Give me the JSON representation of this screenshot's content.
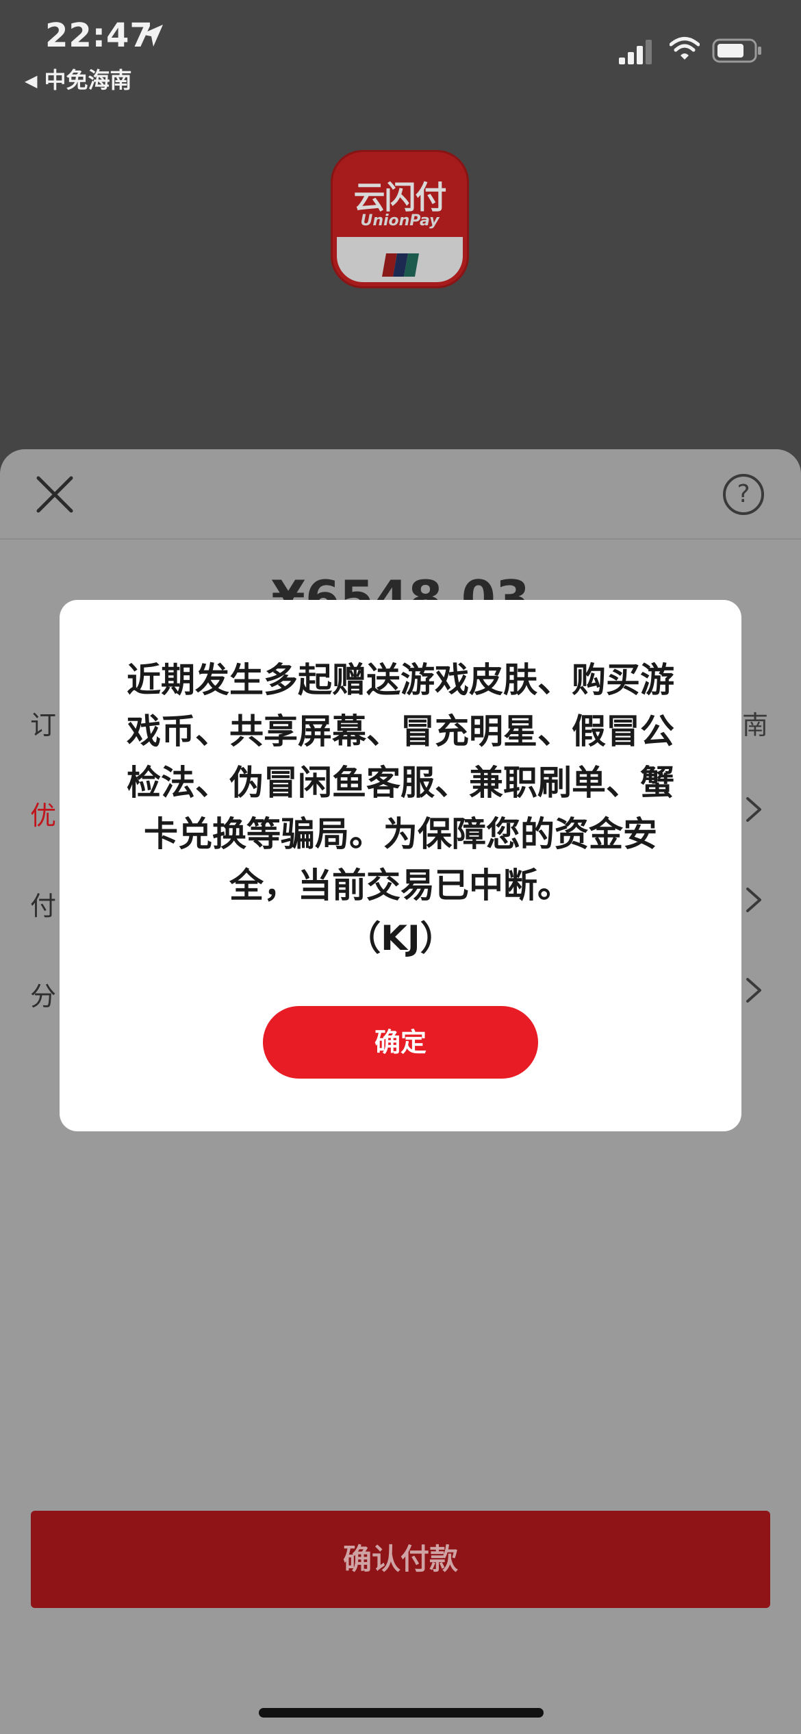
{
  "status_bar": {
    "time": "22:47",
    "back_app": "中免海南",
    "icons": [
      "location-arrow-icon",
      "cellular-signal-icon",
      "wifi-icon",
      "battery-icon"
    ]
  },
  "app_logo": {
    "name_cn": "云闪付",
    "name_en": "UnionPay"
  },
  "payment_sheet": {
    "amount": "¥6548.03",
    "rows": [
      {
        "label": "订",
        "value": "南"
      },
      {
        "label": "优",
        "value": ""
      },
      {
        "label": "付",
        "value": ""
      },
      {
        "label": "分",
        "value": ""
      }
    ],
    "confirm_label": "确认付款"
  },
  "modal": {
    "message": "近期发生多起赠送游戏皮肤、购买游戏币、共享屏幕、冒充明星、假冒公检法、伪冒闲鱼客服、兼职刷单、蟹卡兑换等骗局。为保障您的资金安全，当前交易已中断。",
    "code": "（KJ）",
    "ok_label": "确定"
  },
  "colors": {
    "accent_red": "#e81c24",
    "overlay_confirm": "#8f1418",
    "sheet_background": "#9a9a9a",
    "backdrop": "#454545"
  }
}
